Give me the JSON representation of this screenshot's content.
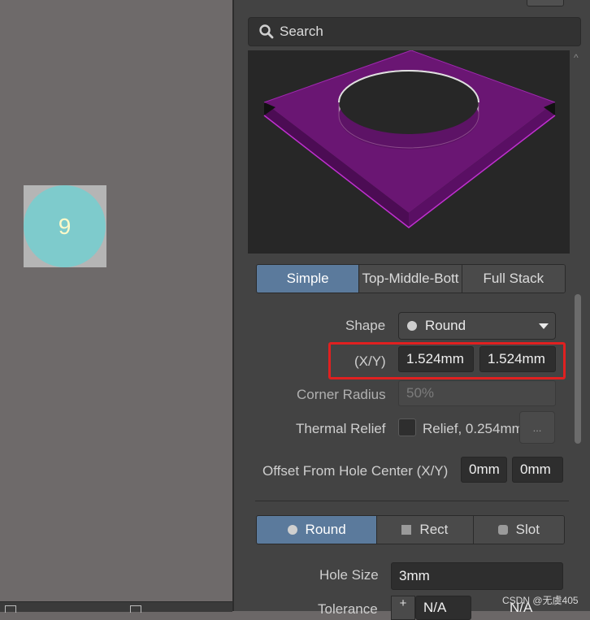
{
  "pad": {
    "number": "9"
  },
  "search": {
    "label": "Search"
  },
  "mode_tabs": {
    "simple": "Simple",
    "top_middle_bottom": "Top-Middle-Bott",
    "full_stack": "Full Stack",
    "active": "Simple"
  },
  "shape": {
    "label": "Shape",
    "value": "Round"
  },
  "size": {
    "label": "(X/Y)",
    "x": "1.524mm",
    "y": "1.524mm"
  },
  "corner_radius": {
    "label": "Corner Radius",
    "placeholder": "50%"
  },
  "thermal_relief": {
    "label": "Thermal Relief",
    "value": "Relief, 0.254mm",
    "button": "..."
  },
  "offset": {
    "label": "Offset From Hole Center (X/Y)",
    "x": "0mm",
    "y": "0mm"
  },
  "hole_tabs": {
    "round": "Round",
    "rect": "Rect",
    "slot": "Slot",
    "active": "Round"
  },
  "hole_size": {
    "label": "Hole Size",
    "value": "3mm"
  },
  "tolerance": {
    "label": "Tolerance",
    "plus": "+",
    "value1": "N/A",
    "value2": "N/A"
  },
  "watermark": "CSDN @无虞405",
  "colors": {
    "accent": "#5b7a9c",
    "pad": "#7ecbcc",
    "pad_text": "#fff9c8",
    "highlight": "#e02020",
    "preview_pad": "#7a1480"
  }
}
